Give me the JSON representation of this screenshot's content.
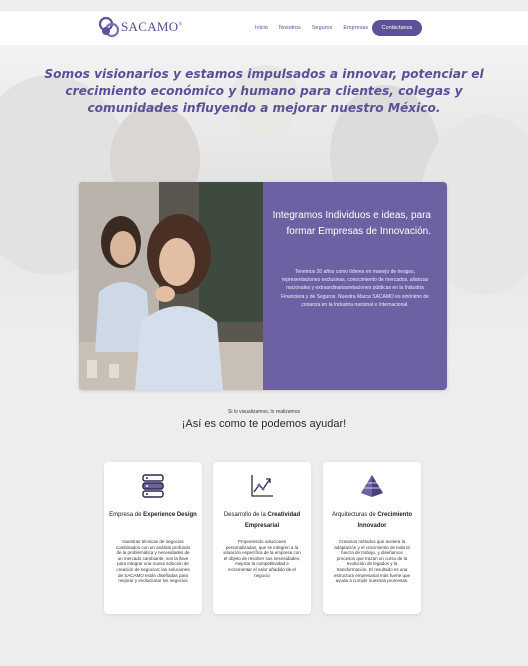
{
  "brand": {
    "name": "SACAMO",
    "mark": "®"
  },
  "nav": {
    "items": [
      "Inicio",
      "Nosotros",
      "Seguros",
      "Empresas"
    ],
    "cta": "Contáctanos"
  },
  "hero": {
    "text": "Somos visionarios y estamos impulsados a innovar, potenciar el crecimiento económico y humano para clientes, colegas y comunidades influyendo a mejorar nuestro México."
  },
  "feature": {
    "heading": "Integramos Individuos e ideas, para formar Empresas de Innovación.",
    "body": "Tenemos 20 años como líderes en manejo de riesgos, representaciones exclusivas, conocimiento de mercados, alianzas nacionales y extraordinariasrelaciones públicas en la Industria Financiera y de Seguros. Nuestra Marca SACAMO es sinónimo de conanza en la Industria nacional e Internacional."
  },
  "section": {
    "subtitle": "Si lo visualizamos, lo realizamos",
    "title": "¡Así es como te podemos ayudar!"
  },
  "cards": [
    {
      "icon": "server-stack-icon",
      "title_pre": "Empresa de ",
      "title_bold": "Experience Design",
      "body": "Nuestras técnicas de negocios combinados con un análisis profundo de la problemática y necesidades de un mercado cambiante, son la llave para integrar una nueva solución de creación de negocios; las soluciones de SACAMO están diseñadas para mejorar y evolucionar los negocios"
    },
    {
      "icon": "growth-chart-icon",
      "title_pre": "Desarrollo de la ",
      "title_bold": "Creatividad Empresarial",
      "body": "Proponiendo soluciones personalizadas, que se integren a la situación específica de la empresa con el objeto de resolver sus necesidades, mejorar la competitividad e incrementar el valor añadido de el negocio"
    },
    {
      "icon": "pyramid-icon",
      "title_pre": "Arquitecturas de ",
      "title_bold": "Crecimiento Innovador",
      "body": "Creamos métodos que acelera la adaptación y el crecimiento de toda la fuerza de trabajo, y diseñamos procesos que trazan un curso de la evolución de legados y la transformación. El resultado es una estructura empresarial más fuerte que ayuda a cumplir nuestras promesas."
    }
  ],
  "colors": {
    "brand_purple": "#5e5199",
    "panel_purple": "#6d61a3"
  }
}
